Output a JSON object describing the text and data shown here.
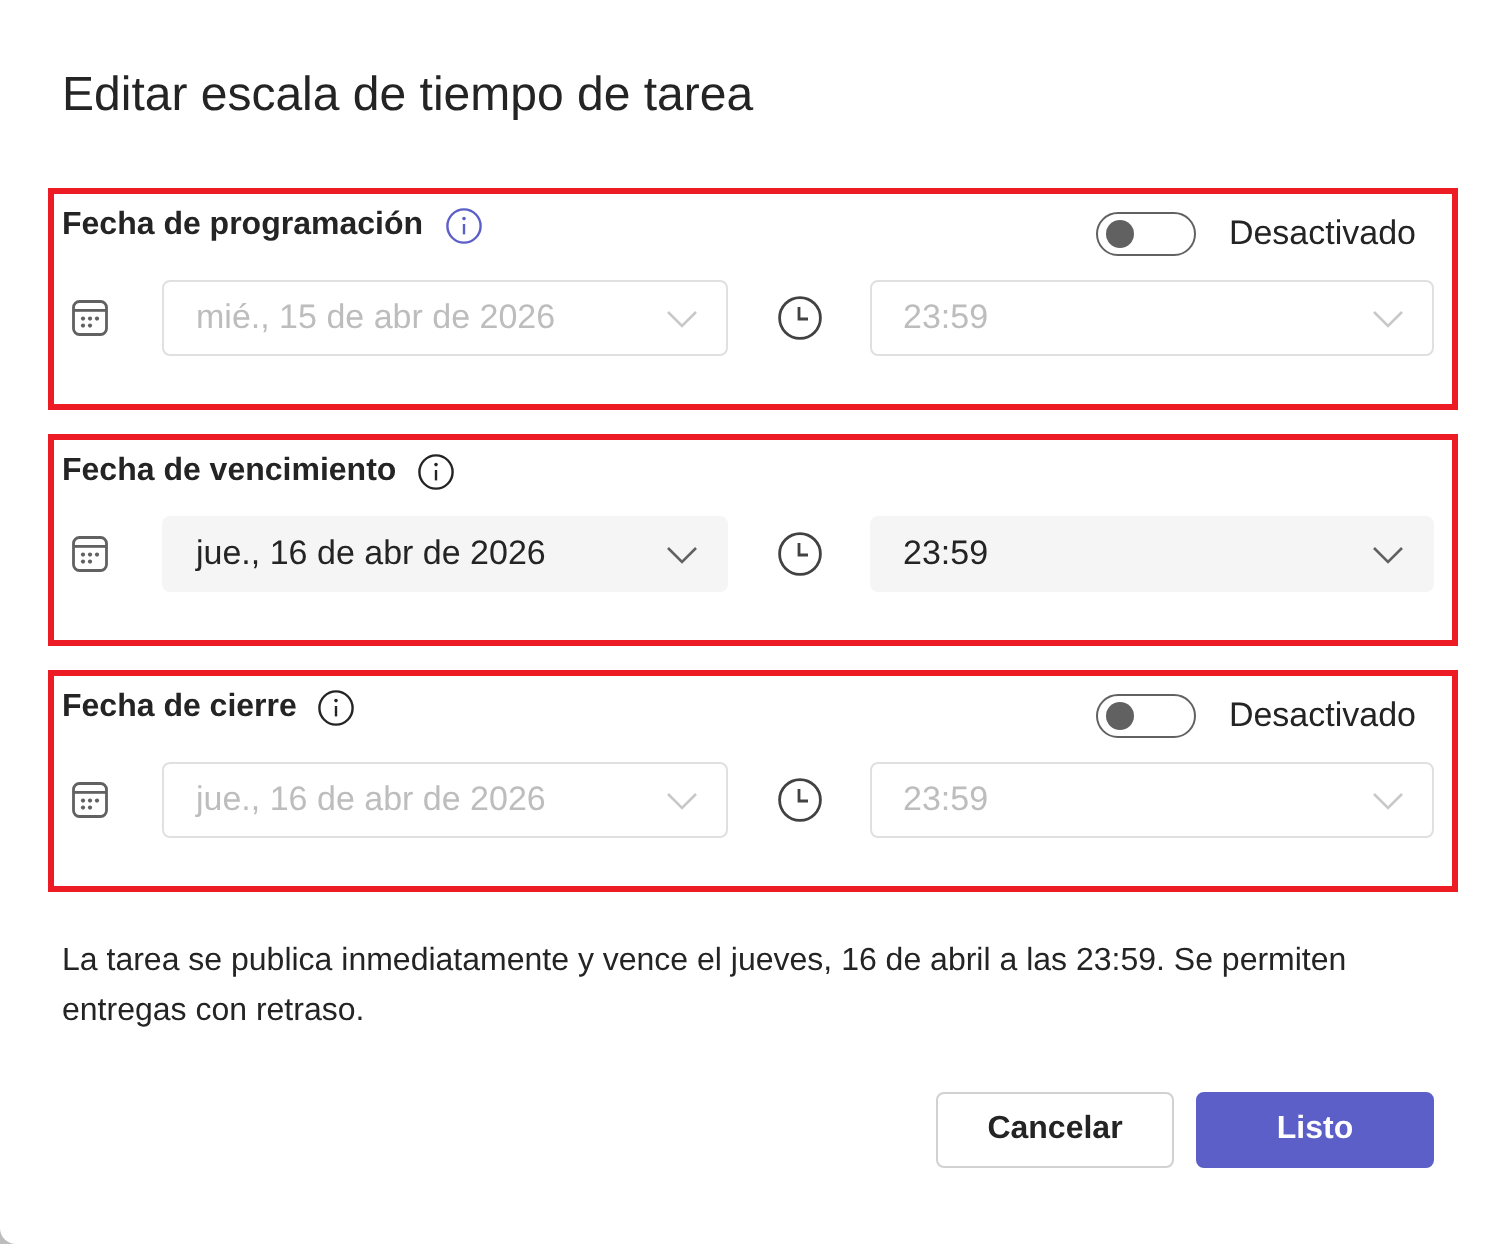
{
  "dialog": {
    "title": "Editar escala de tiempo de tarea"
  },
  "sections": [
    {
      "label": "Fecha de programación",
      "highlighted": true,
      "info_highlighted": true,
      "toggle": {
        "on": false,
        "label": "Desactivado"
      },
      "disabled": true,
      "date": {
        "value": "mié., 15 de abr de 2026"
      },
      "time": {
        "value": "23:59"
      }
    },
    {
      "label": "Fecha de vencimiento",
      "highlighted": true,
      "info_highlighted": false,
      "disabled": false,
      "date": {
        "value": "jue., 16 de abr de 2026"
      },
      "time": {
        "value": "23:59"
      }
    },
    {
      "label": "Fecha de cierre",
      "highlighted": true,
      "info_highlighted": false,
      "toggle": {
        "on": false,
        "label": "Desactivado"
      },
      "disabled": true,
      "date": {
        "value": "jue., 16 de abr de 2026"
      },
      "time": {
        "value": "23:59"
      }
    }
  ],
  "description": "La tarea se publica inmediatamente y vence el jueves, 16 de abril a las 23:59. Se permiten entregas con retraso.",
  "buttons": [
    {
      "label": "Cancelar",
      "kind": "secondary"
    },
    {
      "label": "Listo",
      "kind": "primary"
    }
  ]
}
